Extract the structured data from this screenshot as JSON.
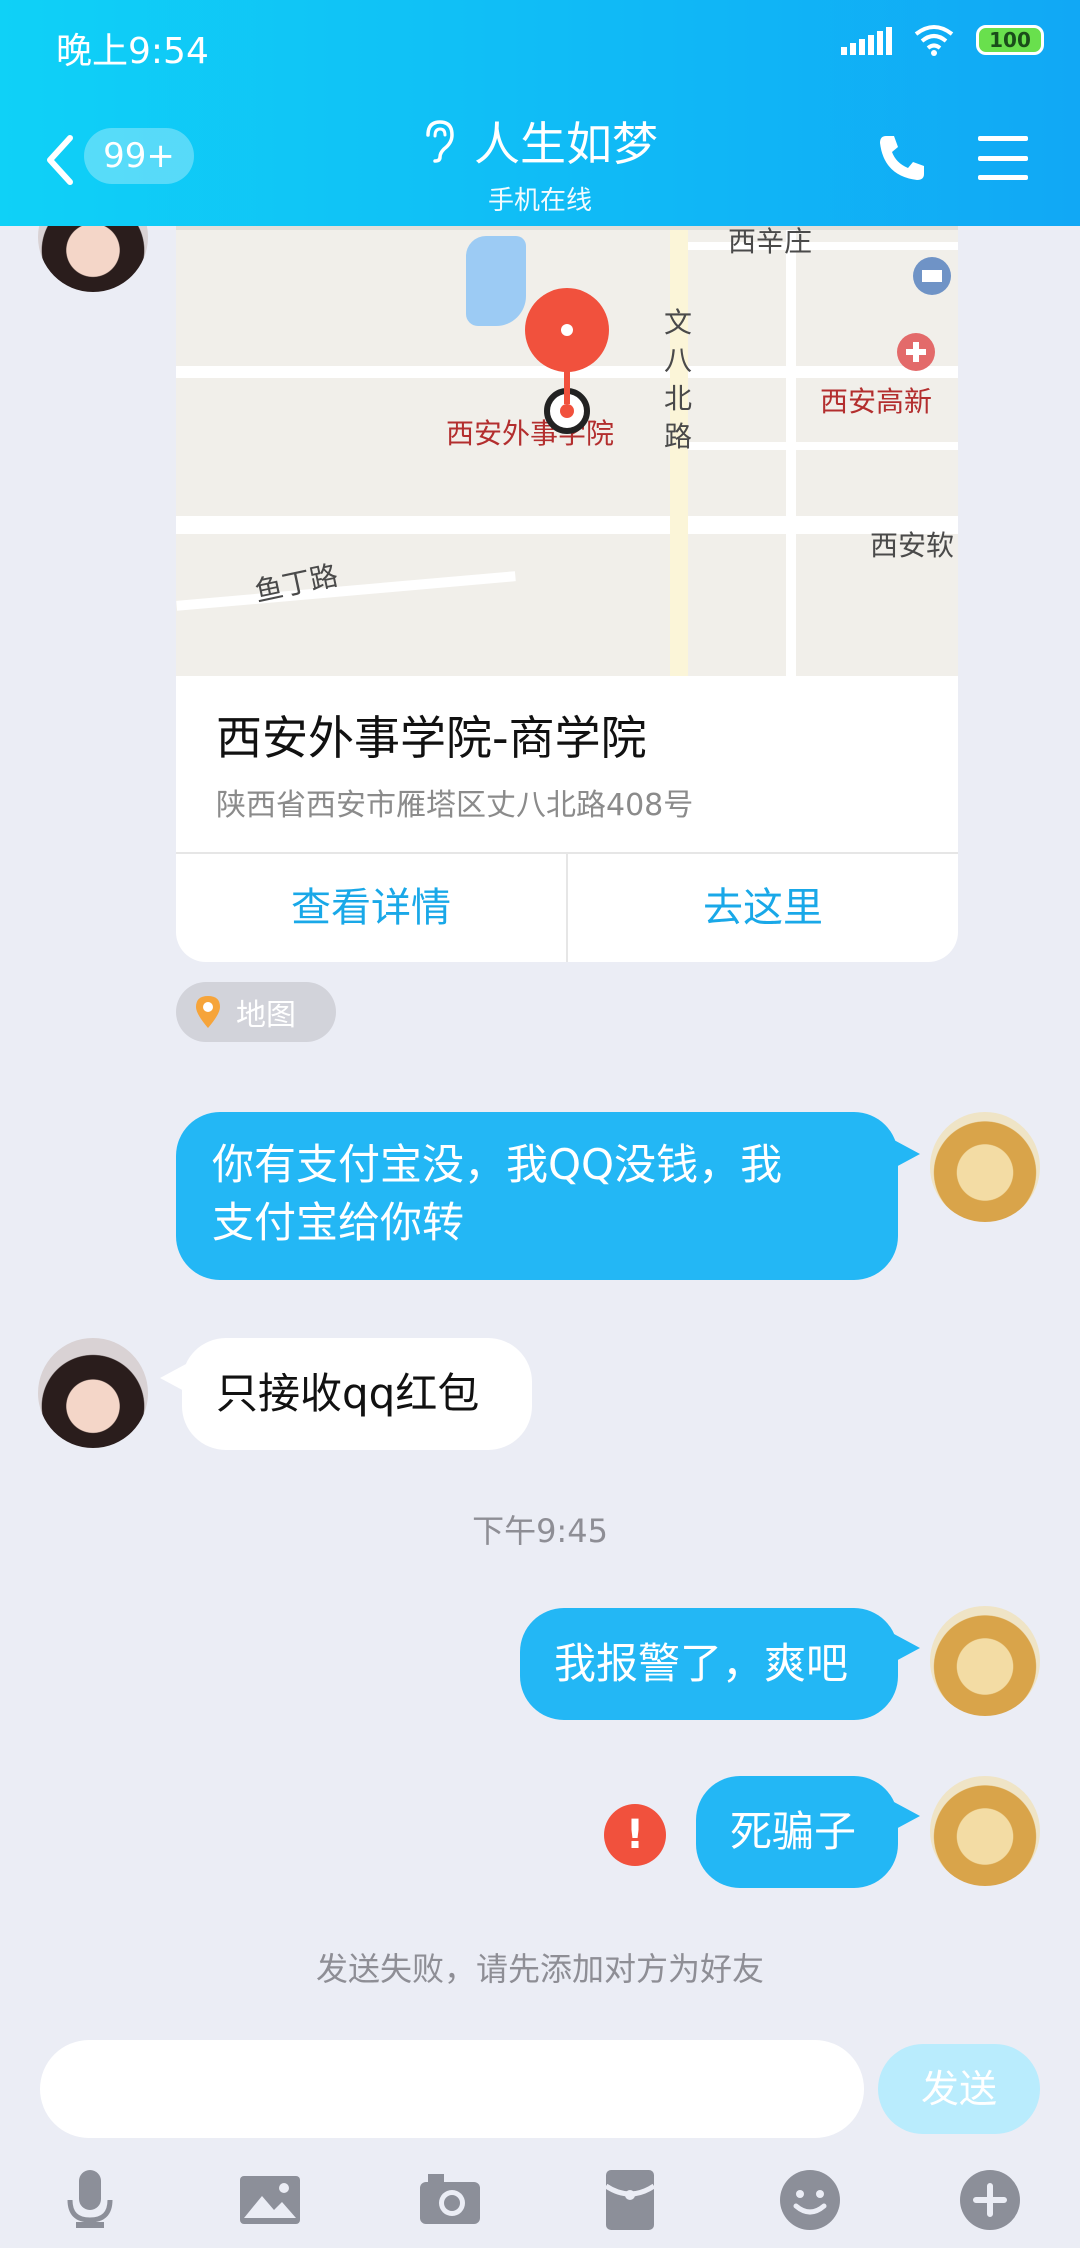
{
  "status_bar": {
    "time": "晚上9:54",
    "battery": "100"
  },
  "header": {
    "unread": "99+",
    "title": "人生如梦",
    "subtitle": "手机在线"
  },
  "location": {
    "map_labels": [
      "西辛庄",
      "文八北路",
      "西安外事学院",
      "西安高新",
      "西安软",
      "鱼丁路"
    ],
    "name": "西安外事学院-商学院",
    "address": "陕西省西安市雁塔区丈八北路408号",
    "action_details": "查看详情",
    "action_go": "去这里",
    "tag": "地图"
  },
  "messages": [
    {
      "side": "out",
      "line1": "你有支付宝没，我QQ没钱，我",
      "line2": "支付宝给你转"
    },
    {
      "side": "in",
      "text": "只接收qq红包"
    },
    {
      "side": "out",
      "text": "我报警了，爽吧"
    },
    {
      "side": "out",
      "text": "死骗子",
      "failed": true
    }
  ],
  "time_separator": "下午9:45",
  "fail_mark": "!",
  "fail_note": "发送失败，请先添加对方为好友",
  "input": {
    "placeholder": "",
    "send_label": "发送"
  },
  "toolbar_icons": [
    "microphone-icon",
    "image-icon",
    "camera-icon",
    "red-packet-icon",
    "emoji-icon",
    "plus-icon"
  ],
  "colors": {
    "header_start": "#0fd1f7",
    "header_end": "#11a8f5",
    "bubble_out": "#23b7f5",
    "fail_red": "#f1513d",
    "link_blue": "#19a8e8"
  }
}
